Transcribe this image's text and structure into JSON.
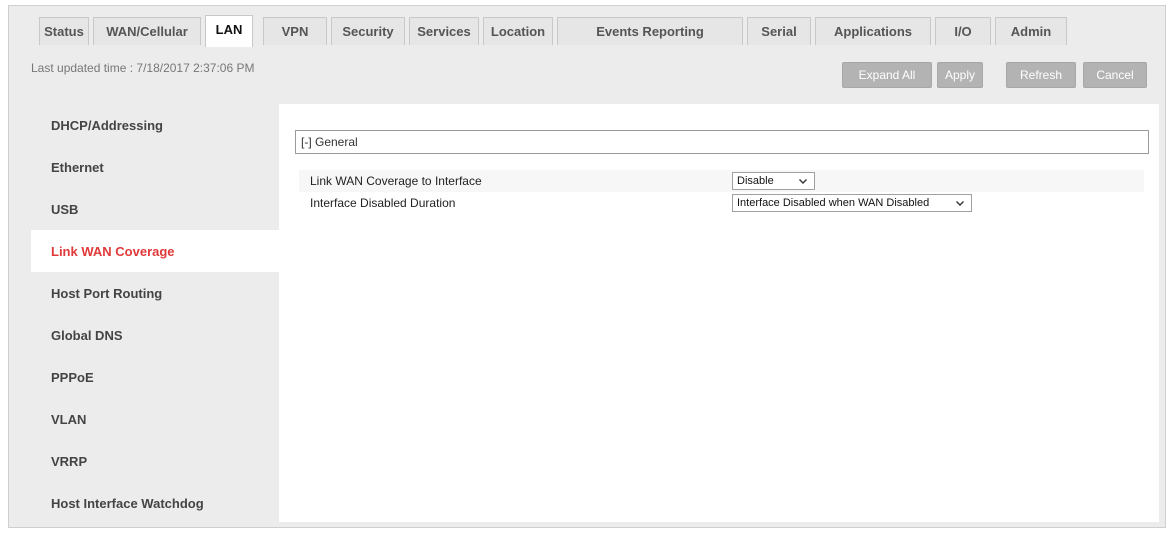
{
  "tabs": [
    {
      "label": "Status",
      "active": false
    },
    {
      "label": "WAN/Cellular",
      "active": false
    },
    {
      "label": "LAN",
      "active": true
    },
    {
      "label": "VPN",
      "active": false
    },
    {
      "label": "Security",
      "active": false
    },
    {
      "label": "Services",
      "active": false
    },
    {
      "label": "Location",
      "active": false
    },
    {
      "label": "Events Reporting",
      "active": false
    },
    {
      "label": "Serial",
      "active": false
    },
    {
      "label": "Applications",
      "active": false
    },
    {
      "label": "I/O",
      "active": false
    },
    {
      "label": "Admin",
      "active": false
    }
  ],
  "last_updated": "Last updated time : 7/18/2017 2:37:06 PM",
  "toolbar": {
    "expand_all": "Expand All",
    "apply": "Apply",
    "refresh": "Refresh",
    "cancel": "Cancel"
  },
  "sidebar": {
    "items": [
      {
        "label": "DHCP/Addressing",
        "active": false
      },
      {
        "label": "Ethernet",
        "active": false
      },
      {
        "label": "USB",
        "active": false
      },
      {
        "label": "Link WAN Coverage",
        "active": true
      },
      {
        "label": "Host Port Routing",
        "active": false
      },
      {
        "label": "Global DNS",
        "active": false
      },
      {
        "label": "PPPoE",
        "active": false
      },
      {
        "label": "VLAN",
        "active": false
      },
      {
        "label": "VRRP",
        "active": false
      },
      {
        "label": "Host Interface Watchdog",
        "active": false
      }
    ]
  },
  "section": {
    "header": "[-] General"
  },
  "fields": [
    {
      "label": "Link WAN Coverage to Interface",
      "value": "Disable"
    },
    {
      "label": "Interface Disabled Duration",
      "value": "Interface Disabled when WAN Disabled"
    }
  ],
  "colors": {
    "accent_active": "#e0393a",
    "button_gray": "#b3b3b3",
    "panel_gray": "#ececec"
  }
}
